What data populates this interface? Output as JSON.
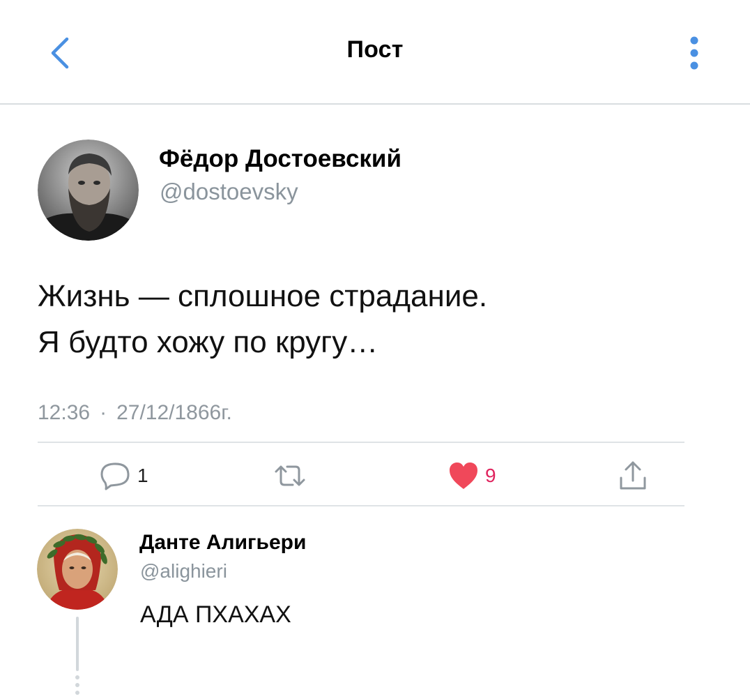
{
  "header": {
    "title": "Пост",
    "back_icon": "chevron-left-icon",
    "more_icon": "vertical-dots-icon",
    "accent_color": "#4a90e2"
  },
  "tweet": {
    "author": {
      "display_name": "Фёдор Достоевский",
      "handle": "@dostoevsky"
    },
    "text_lines": [
      "Жизнь — сплошное страдание.",
      "Я будто хожу по кругу…"
    ],
    "time": "12:36",
    "separator": "·",
    "date": "27/12/1866г.",
    "actions": {
      "reply": {
        "icon": "reply-bubble-icon",
        "count": "1"
      },
      "retweet": {
        "icon": "retweet-icon",
        "count": ""
      },
      "like": {
        "icon": "heart-icon",
        "count": "9",
        "liked": true,
        "color": "#e0245e"
      },
      "share": {
        "icon": "share-icon",
        "count": ""
      }
    }
  },
  "reply": {
    "author": {
      "display_name": "Данте Алигьери",
      "handle": "@alighieri"
    },
    "text": "АДА ПХАХАХ"
  }
}
